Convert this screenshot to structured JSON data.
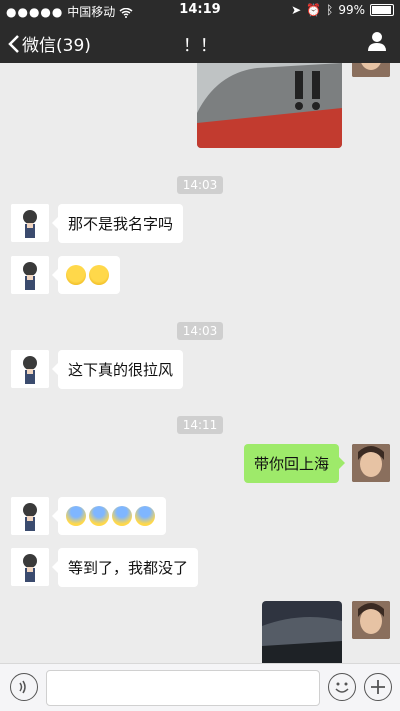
{
  "status_bar": {
    "carrier": "中国移动",
    "time": "14:19",
    "battery": "99%"
  },
  "nav": {
    "back_label": "微信(39)",
    "title": "！！"
  },
  "messages": [
    {
      "type": "image",
      "side": "right"
    },
    {
      "type": "time",
      "text": "14:03"
    },
    {
      "type": "text",
      "side": "left",
      "text": "那不是我名字吗"
    },
    {
      "type": "emoji",
      "side": "left",
      "emojis": [
        "laughing-crying-emoji",
        "laughing-crying-emoji"
      ]
    },
    {
      "type": "time",
      "text": "14:03"
    },
    {
      "type": "text",
      "side": "left",
      "text": "这下真的很拉风"
    },
    {
      "type": "time",
      "text": "14:11"
    },
    {
      "type": "text",
      "side": "right",
      "text": "带你回上海"
    },
    {
      "type": "emoji",
      "side": "left",
      "emojis": [
        "scream-emoji",
        "scream-emoji",
        "scream-emoji",
        "scream-emoji"
      ]
    },
    {
      "type": "text",
      "side": "left",
      "text": "等到了，我都没了"
    },
    {
      "type": "image",
      "side": "right"
    }
  ],
  "colors": {
    "nav_bg": "#2b2b2b",
    "chat_bg": "#ececec",
    "sent_bubble": "#9eea6a",
    "received_bubble": "#ffffff"
  },
  "icons": {
    "back": "chevron-left-icon",
    "profile": "person-icon",
    "voice": "voice-icon",
    "emoji": "smiley-icon",
    "more": "plus-icon"
  }
}
